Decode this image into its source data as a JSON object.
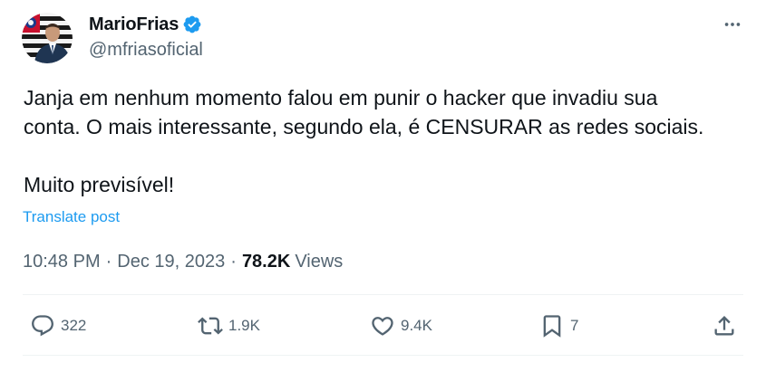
{
  "author": {
    "display_name": "MarioFrias",
    "handle": "@mfriasoficial",
    "verified": true,
    "avatar_icon": "profile-photo",
    "verified_color": "#1d9bf0"
  },
  "post": {
    "line1": "Janja em nenhum momento falou em punir o hacker que invadiu sua",
    "line2": "conta. O mais interessante, segundo ela, é CENSURAR as redes sociais.",
    "line3": "Muito previsível!",
    "translate_label": "Translate post"
  },
  "meta": {
    "time": "10:48 PM",
    "separator": "·",
    "date": "Dec 19, 2023",
    "separator2": "·",
    "views_count": "78.2K",
    "views_label": "Views"
  },
  "actions": {
    "replies": "322",
    "reposts": "1.9K",
    "likes": "9.4K",
    "bookmarks": "7"
  },
  "colors": {
    "accent": "#1d9bf0",
    "text_primary": "#0f1419",
    "text_secondary": "#536471",
    "divider": "#eff3f4"
  }
}
